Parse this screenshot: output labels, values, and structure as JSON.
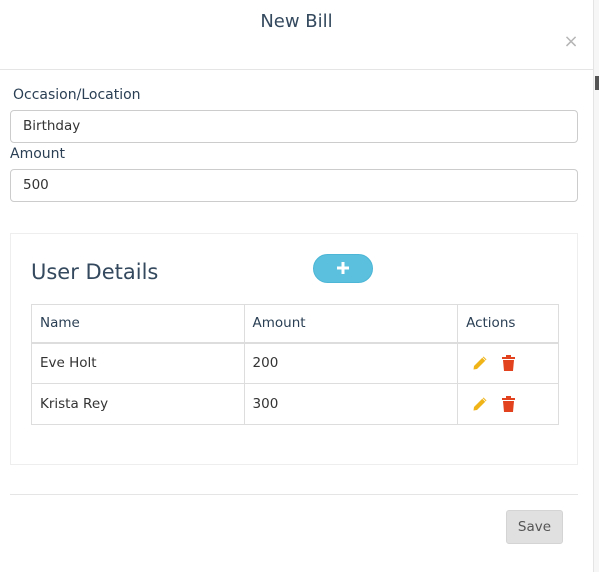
{
  "modal": {
    "title": "New Bill",
    "close_label": "×"
  },
  "form": {
    "occasion_label": "Occasion/Location",
    "occasion_value": "Birthday",
    "amount_label": "Amount",
    "amount_value": "500"
  },
  "user_details": {
    "title": "User Details",
    "add_icon": "plus-icon",
    "columns": [
      "Name",
      "Amount",
      "Actions"
    ],
    "rows": [
      {
        "name": "Eve Holt",
        "amount": "200"
      },
      {
        "name": "Krista Rey",
        "amount": "300"
      }
    ],
    "edit_icon": "pencil-icon",
    "delete_icon": "trash-icon"
  },
  "footer": {
    "save_label": "Save"
  },
  "colors": {
    "accent": "#5bc0de",
    "edit": "#f0b419",
    "delete": "#e3421e",
    "title_text": "#34495e"
  }
}
